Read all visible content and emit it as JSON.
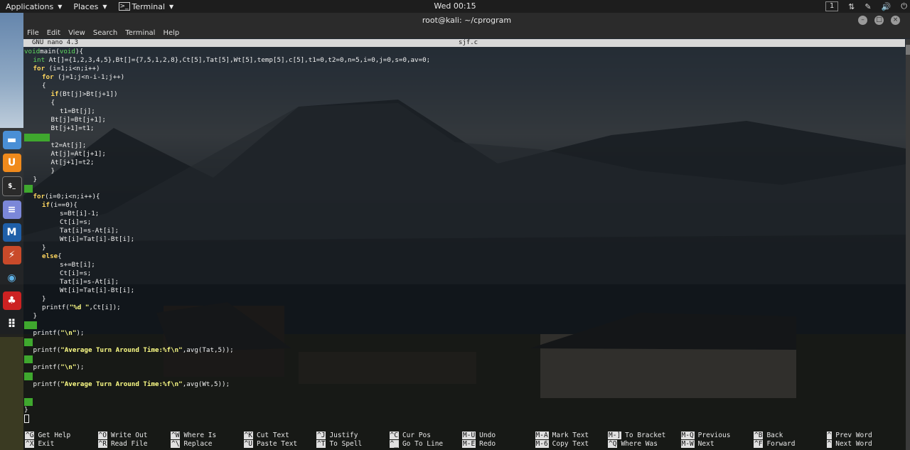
{
  "top_panel": {
    "applications_label": "Applications",
    "places_label": "Places",
    "terminal_label": "Terminal",
    "clock": "Wed 00:15",
    "workspace": "1"
  },
  "window": {
    "title": "root@kali: ~/cprogram",
    "menu": [
      "File",
      "Edit",
      "View",
      "Search",
      "Terminal",
      "Help"
    ]
  },
  "nano": {
    "version": "GNU nano 4.3",
    "filename": "sjf.c"
  },
  "code_lines": [
    {
      "indent": 0,
      "parts": [
        [
          "ty",
          "void"
        ],
        [
          "",
          "main("
        ],
        [
          "ty",
          "void"
        ],
        [
          "",
          ")"
        ],
        [
          "",
          "{"
        ]
      ]
    },
    {
      "indent": 1,
      "parts": [
        [
          "ty",
          "int"
        ],
        [
          "",
          " At[]={1,2,3,4,5},Bt[]={7,5,1,2,8},Ct[5],Tat[5],Wt[5],temp[5],c[5],t1=0,t2=0,n=5,i=0,j=0,s=0,av=0;"
        ]
      ]
    },
    {
      "indent": 1,
      "parts": [
        [
          "kw",
          "for"
        ],
        [
          "",
          " (i=1;i<n;i++)"
        ]
      ]
    },
    {
      "indent": 2,
      "parts": [
        [
          "kw",
          "for"
        ],
        [
          "",
          " (j=1;j<n-i-1;j++)"
        ]
      ]
    },
    {
      "indent": 2,
      "parts": [
        [
          "",
          "{"
        ]
      ]
    },
    {
      "indent": 3,
      "parts": [
        [
          "kw",
          "if"
        ],
        [
          "",
          "(Bt[j]>Bt[j+1])"
        ]
      ]
    },
    {
      "indent": 3,
      "parts": [
        [
          "",
          "{"
        ]
      ]
    },
    {
      "indent": 4,
      "parts": [
        [
          "",
          "t1=Bt[j];"
        ]
      ]
    },
    {
      "indent": 3,
      "parts": [
        [
          "",
          "Bt[j]=Bt[j+1];"
        ]
      ]
    },
    {
      "indent": 3,
      "parts": [
        [
          "",
          "Bt[j+1]=t1;"
        ]
      ]
    },
    {
      "indent": 0,
      "parts": [],
      "highlight": 36
    },
    {
      "indent": 3,
      "parts": [
        [
          "",
          "t2=At[j];"
        ]
      ]
    },
    {
      "indent": 3,
      "parts": [
        [
          "",
          "At[j]=At[j+1];"
        ]
      ]
    },
    {
      "indent": 3,
      "parts": [
        [
          "",
          "At[j+1]=t2;"
        ]
      ]
    },
    {
      "indent": 3,
      "parts": [
        [
          "",
          "}"
        ]
      ]
    },
    {
      "indent": 1,
      "parts": [
        [
          "",
          "}"
        ]
      ]
    },
    {
      "indent": 0,
      "parts": [],
      "highlight": 12
    },
    {
      "indent": 1,
      "parts": [
        [
          "kw",
          "for"
        ],
        [
          "",
          "(i=0;i<n;i++){"
        ]
      ]
    },
    {
      "indent": 2,
      "parts": [
        [
          "kw",
          "if"
        ],
        [
          "",
          "(i==0){"
        ]
      ]
    },
    {
      "indent": 4,
      "parts": [
        [
          "",
          "s=Bt[i]-1;"
        ]
      ]
    },
    {
      "indent": 4,
      "parts": [
        [
          "",
          "Ct[i]=s;"
        ]
      ]
    },
    {
      "indent": 4,
      "parts": [
        [
          "",
          "Tat[i]=s-At[i];"
        ]
      ]
    },
    {
      "indent": 4,
      "parts": [
        [
          "",
          "Wt[i]=Tat[i]-Bt[i];"
        ]
      ]
    },
    {
      "indent": 2,
      "parts": [
        [
          "",
          "}"
        ]
      ]
    },
    {
      "indent": 2,
      "parts": [
        [
          "kw",
          "else"
        ],
        [
          "",
          "{"
        ]
      ]
    },
    {
      "indent": 4,
      "parts": [
        [
          "",
          "s+=Bt[i];"
        ]
      ]
    },
    {
      "indent": 4,
      "parts": [
        [
          "",
          "Ct[i]=s;"
        ]
      ]
    },
    {
      "indent": 4,
      "parts": [
        [
          "",
          "Tat[i]=s-At[i];"
        ]
      ]
    },
    {
      "indent": 4,
      "parts": [
        [
          "",
          "Wt[i]=Tat[i]-Bt[i];"
        ]
      ]
    },
    {
      "indent": 2,
      "parts": [
        [
          "",
          "}"
        ]
      ]
    },
    {
      "indent": 2,
      "parts": [
        [
          "",
          "printf("
        ],
        [
          "str",
          "\"%d \""
        ],
        [
          "",
          ",Ct[i]);"
        ]
      ]
    },
    {
      "indent": 1,
      "parts": [
        [
          "",
          "}"
        ]
      ]
    },
    {
      "indent": 0,
      "parts": [],
      "highlight": 18
    },
    {
      "indent": 1,
      "parts": [
        [
          "",
          "printf("
        ],
        [
          "str",
          "\"\\n\""
        ],
        [
          "",
          ");"
        ]
      ]
    },
    {
      "indent": 0,
      "parts": [],
      "highlight": 12
    },
    {
      "indent": 1,
      "parts": [
        [
          "",
          "printf("
        ],
        [
          "str",
          "\"Average Turn Around Time:%f\\n\""
        ],
        [
          "",
          ",avg(Tat,5));"
        ]
      ]
    },
    {
      "indent": 0,
      "parts": [],
      "highlight": 12
    },
    {
      "indent": 1,
      "parts": [
        [
          "",
          "printf("
        ],
        [
          "str",
          "\"\\n\""
        ],
        [
          "",
          ");"
        ]
      ]
    },
    {
      "indent": 0,
      "parts": [],
      "highlight": 12
    },
    {
      "indent": 1,
      "parts": [
        [
          "",
          "printf("
        ],
        [
          "str",
          "\"Average Turn Around Time:%f\\n\""
        ],
        [
          "",
          ",avg(Wt,5));"
        ]
      ]
    },
    {
      "indent": 0,
      "parts": []
    },
    {
      "indent": 0,
      "parts": [],
      "highlight": 12
    },
    {
      "indent": 0,
      "parts": [
        [
          "",
          "}"
        ]
      ]
    },
    {
      "indent": 0,
      "parts": [],
      "cursor": true
    }
  ],
  "shortcuts": [
    {
      "k1": "^G",
      "l1": "Get Help",
      "k2": "^X",
      "l2": "Exit"
    },
    {
      "k1": "^O",
      "l1": "Write Out",
      "k2": "^R",
      "l2": "Read File"
    },
    {
      "k1": "^W",
      "l1": "Where Is",
      "k2": "^\\",
      "l2": "Replace"
    },
    {
      "k1": "^K",
      "l1": "Cut Text",
      "k2": "^U",
      "l2": "Paste Text"
    },
    {
      "k1": "^J",
      "l1": "Justify",
      "k2": "^T",
      "l2": "To Spell"
    },
    {
      "k1": "^C",
      "l1": "Cur Pos",
      "k2": "^_",
      "l2": "Go To Line"
    },
    {
      "k1": "M-U",
      "l1": "Undo",
      "k2": "M-E",
      "l2": "Redo"
    },
    {
      "k1": "M-A",
      "l1": "Mark Text",
      "k2": "M-6",
      "l2": "Copy Text"
    },
    {
      "k1": "M-]",
      "l1": "To Bracket",
      "k2": "^Q",
      "l2": "Where Was"
    },
    {
      "k1": "M-Q",
      "l1": "Previous",
      "k2": "M-W",
      "l2": "Next"
    },
    {
      "k1": "^B",
      "l1": "Back",
      "k2": "^F",
      "l2": "Forward"
    },
    {
      "k1": "^",
      "l1": "Prev Word",
      "k2": "^",
      "l2": "Next Word"
    }
  ],
  "dock_icons": [
    "files-icon",
    "burpsuite-icon",
    "terminal-icon",
    "text-editor-icon",
    "metasploit-icon",
    "armitage-icon",
    "eye-icon",
    "cherrytree-icon",
    "app-grid-icon"
  ]
}
